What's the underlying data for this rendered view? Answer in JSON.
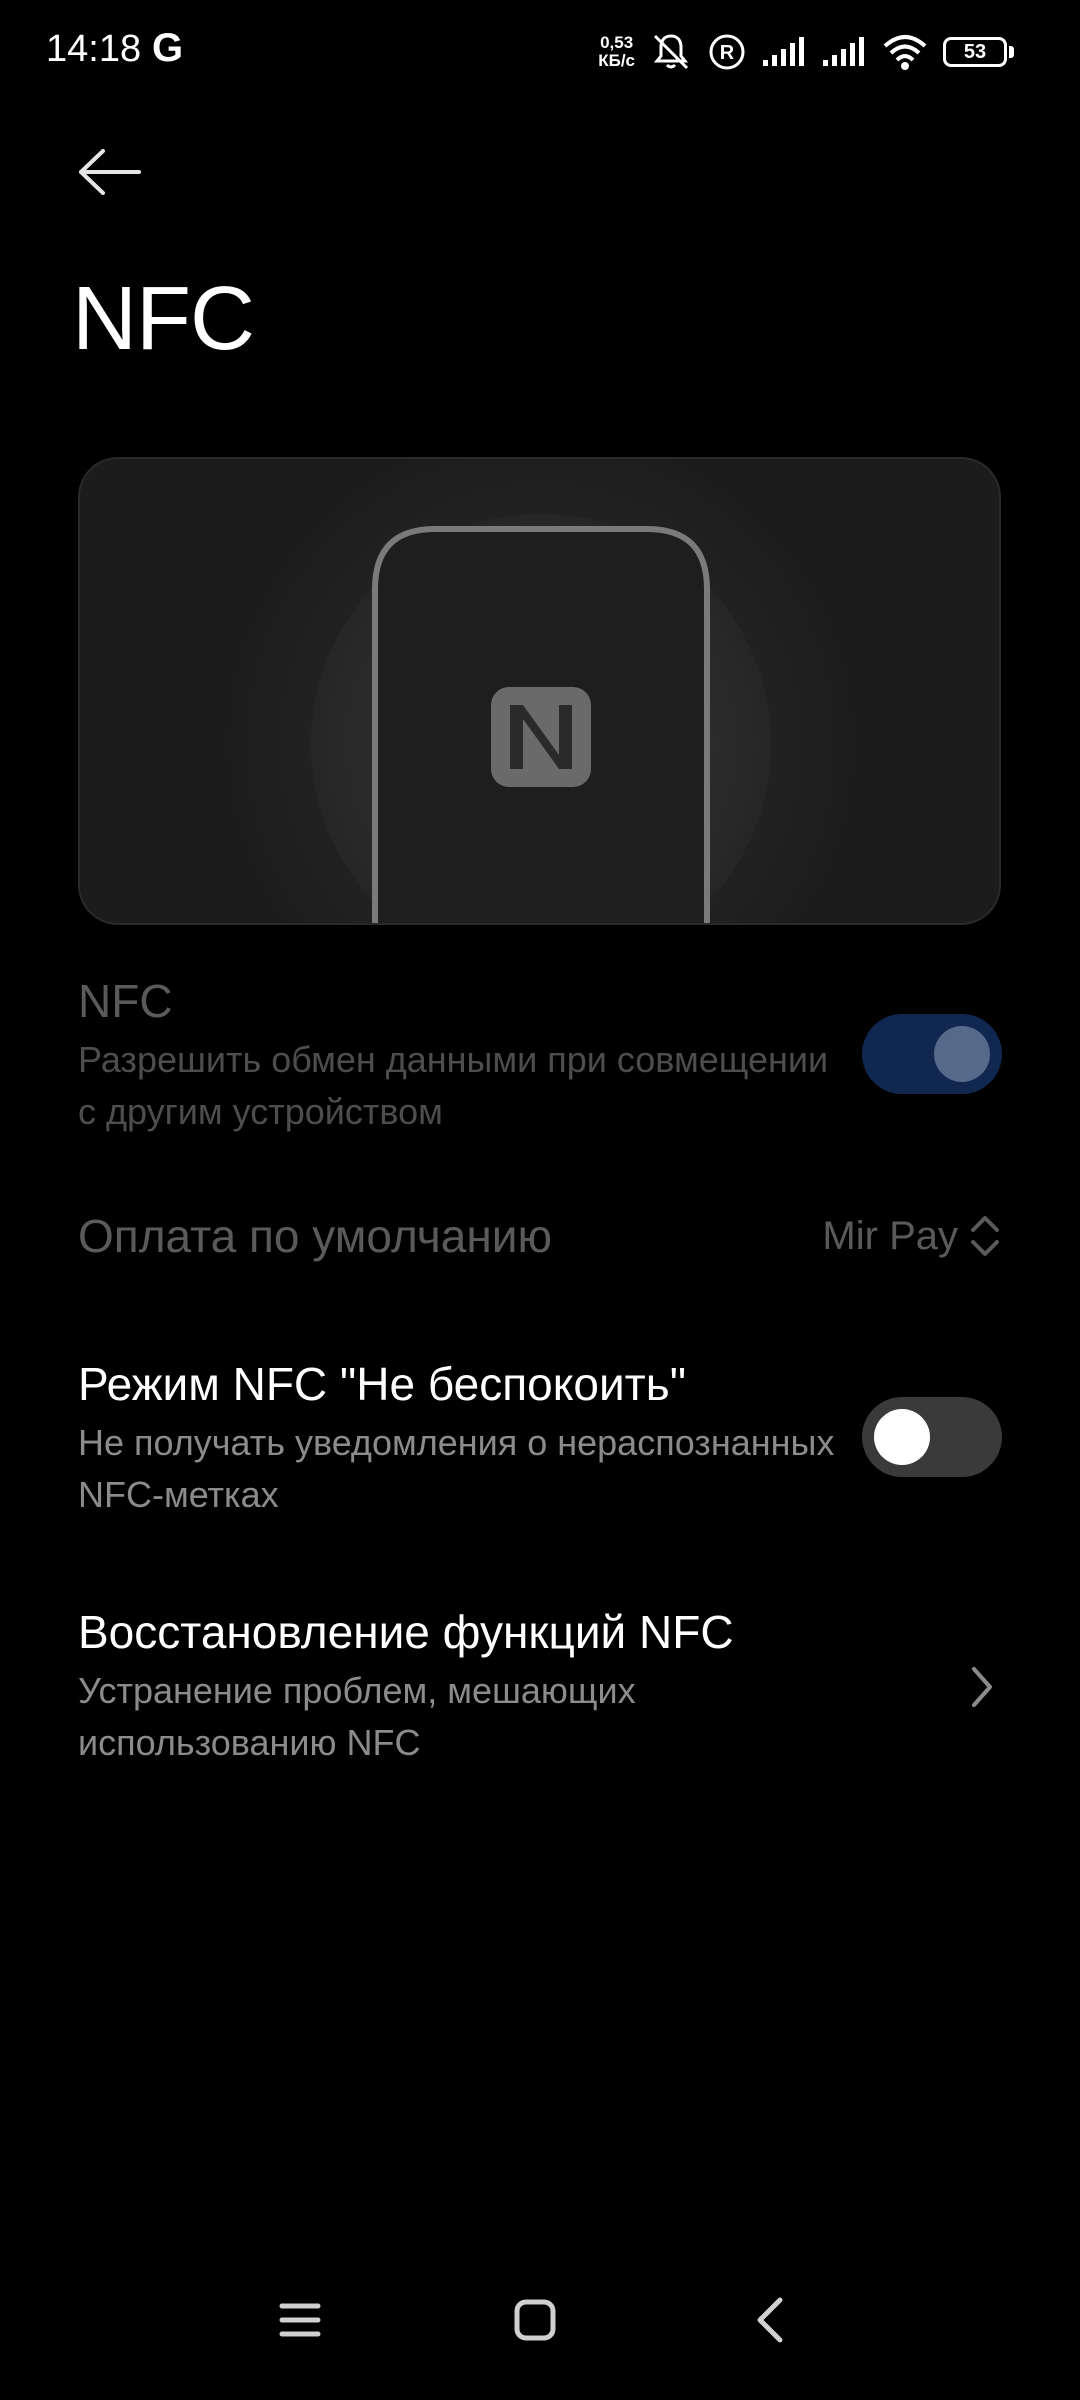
{
  "status_bar": {
    "time": "14:18",
    "carrier_icon": "G",
    "speed_value": "0,53",
    "speed_unit": "КБ/с",
    "icons": [
      "silent-icon",
      "roaming-icon",
      "signal-icon",
      "signal-icon",
      "wifi-icon"
    ],
    "battery_level": "53"
  },
  "header": {
    "title": "NFC"
  },
  "nfc_row": {
    "title": "NFC",
    "subtitle": "Разрешить обмен данными при совмещении с другим устройством",
    "enabled": true
  },
  "payment_row": {
    "title": "Оплата по умолчанию",
    "value": "Mir Pay"
  },
  "dnd_row": {
    "title": "Режим NFC \"Не беспокоить\"",
    "subtitle": "Не получать уведомления о нераспознанных NFC-метках",
    "enabled": false
  },
  "restore_row": {
    "title": "Восстановление функций NFC",
    "subtitle": "Устранение проблем, мешающих использованию NFC"
  },
  "colors": {
    "background": "#000000",
    "toggle_on": "#102850",
    "toggle_off": "#3a3a3a",
    "muted_text": "#8b8b8b"
  }
}
